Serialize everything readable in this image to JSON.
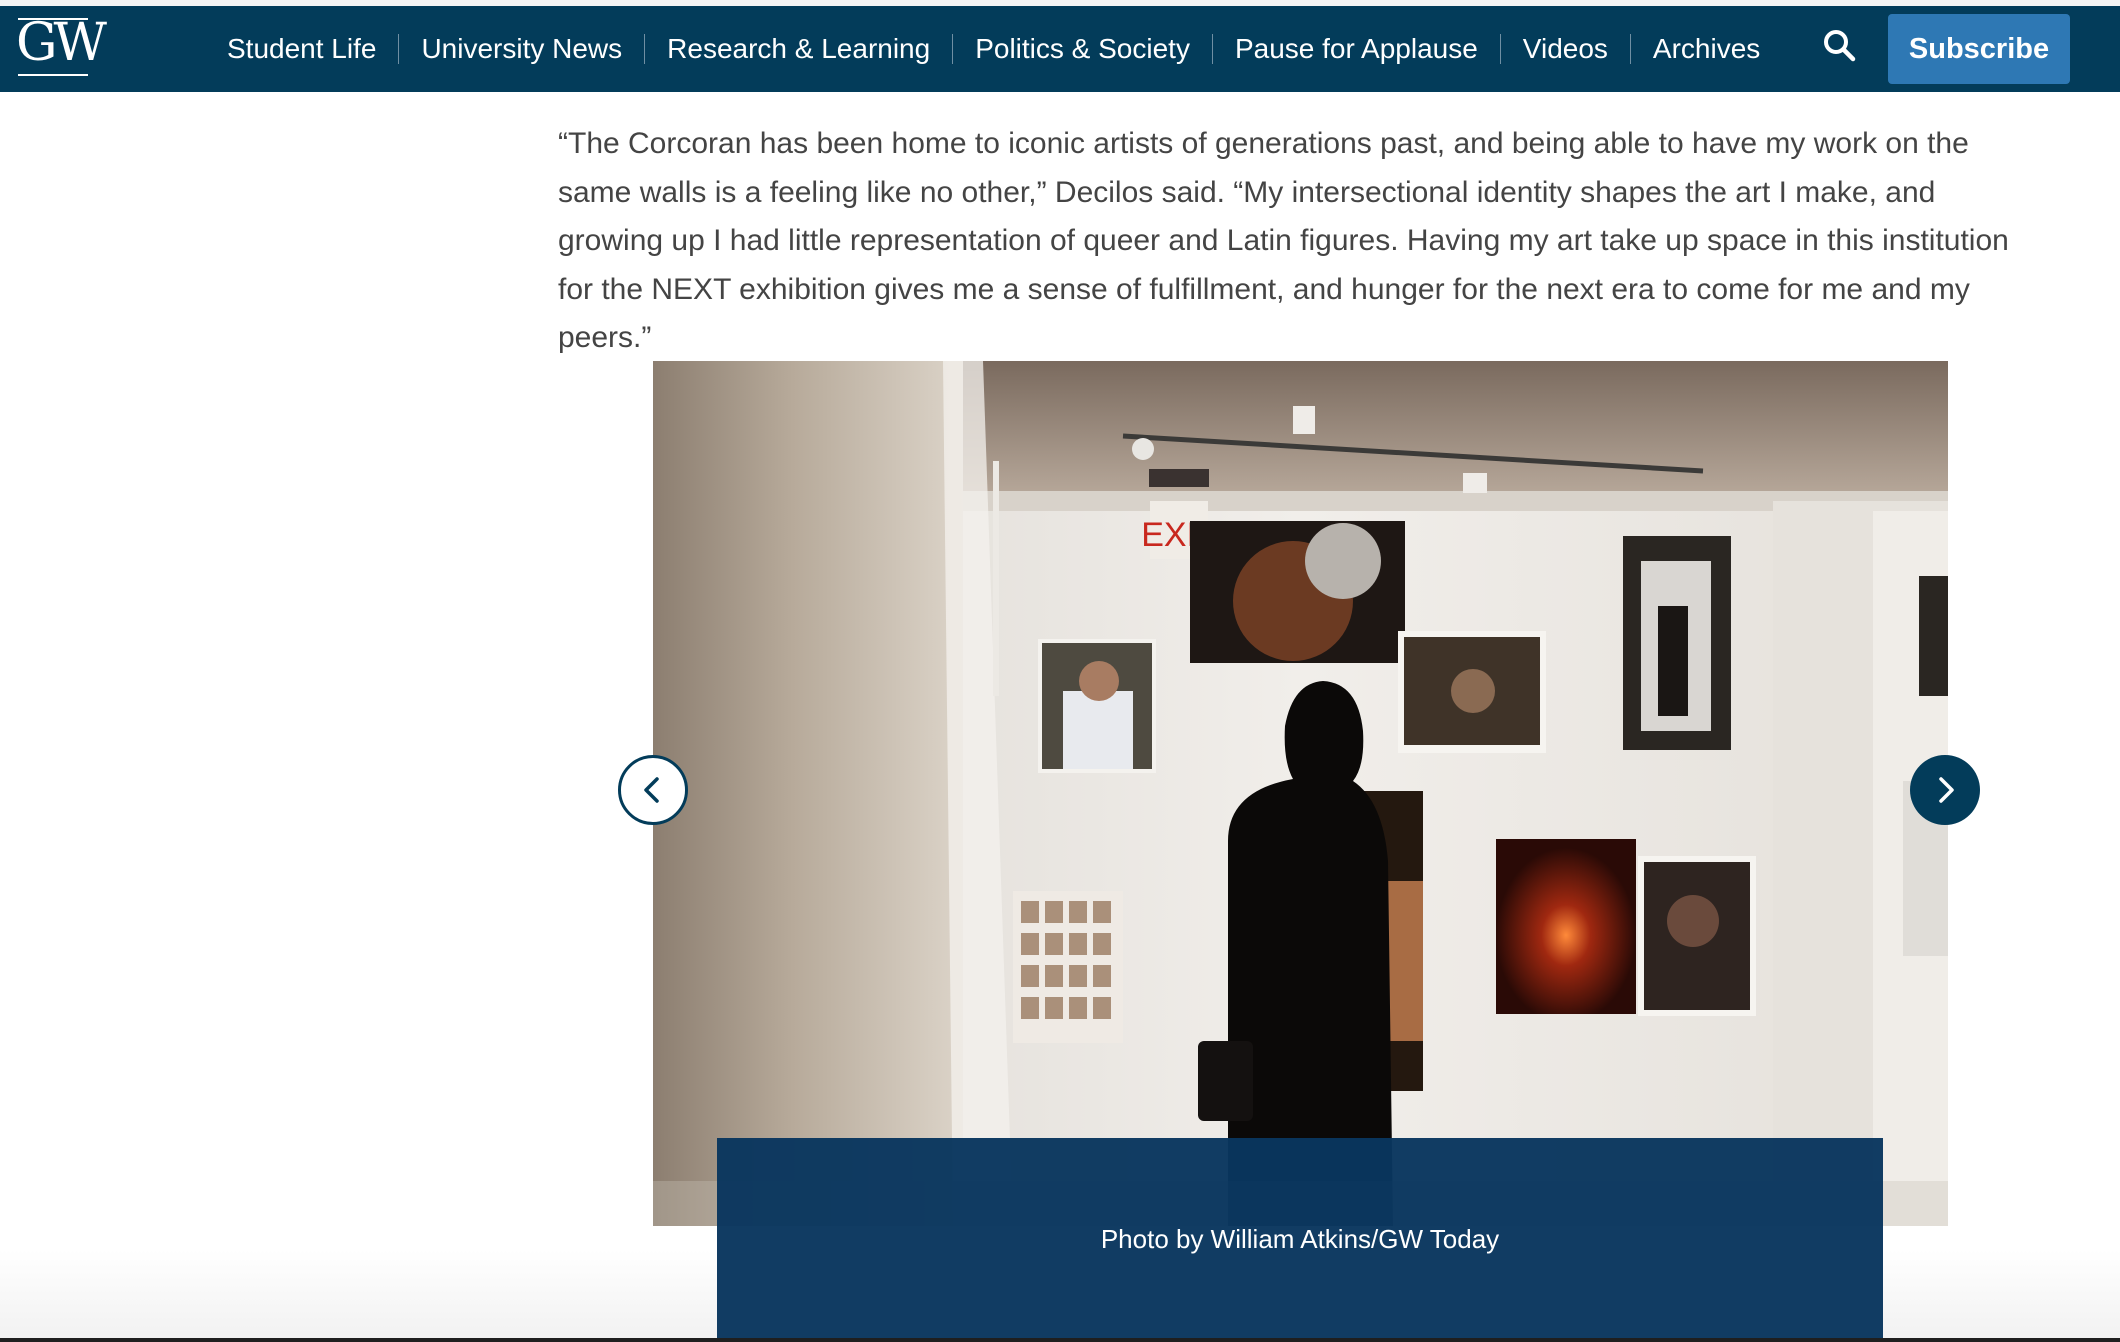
{
  "site": {
    "logo_text": "GW"
  },
  "nav": {
    "items": [
      "Student Life",
      "University News",
      "Research & Learning",
      "Politics & Society",
      "Pause for Applause",
      "Videos",
      "Archives"
    ],
    "search_icon": "search-icon",
    "subscribe_label": "Subscribe"
  },
  "article": {
    "quote": "“The Corcoran has been home to iconic artists of generations past, and being able to have my work on the same walls is a feeling like no other,” Decilos said. “My intersectional identity shapes the art I make, and growing up I had little representation of queer and Latin figures. Having my art take up space in this institution for the NEXT exhibition gives me a sense of fulfillment, and hunger for the next era to come for me and my peers.”"
  },
  "carousel": {
    "prev_icon": "chevron-left-icon",
    "next_icon": "chevron-right-icon",
    "caption": "Photo by William Atkins/GW Today",
    "exit_sign": "EXIT"
  },
  "colors": {
    "nav_bg": "#033c5a",
    "subscribe_bg": "#2e78b4",
    "caption_bg": "#09365e"
  }
}
